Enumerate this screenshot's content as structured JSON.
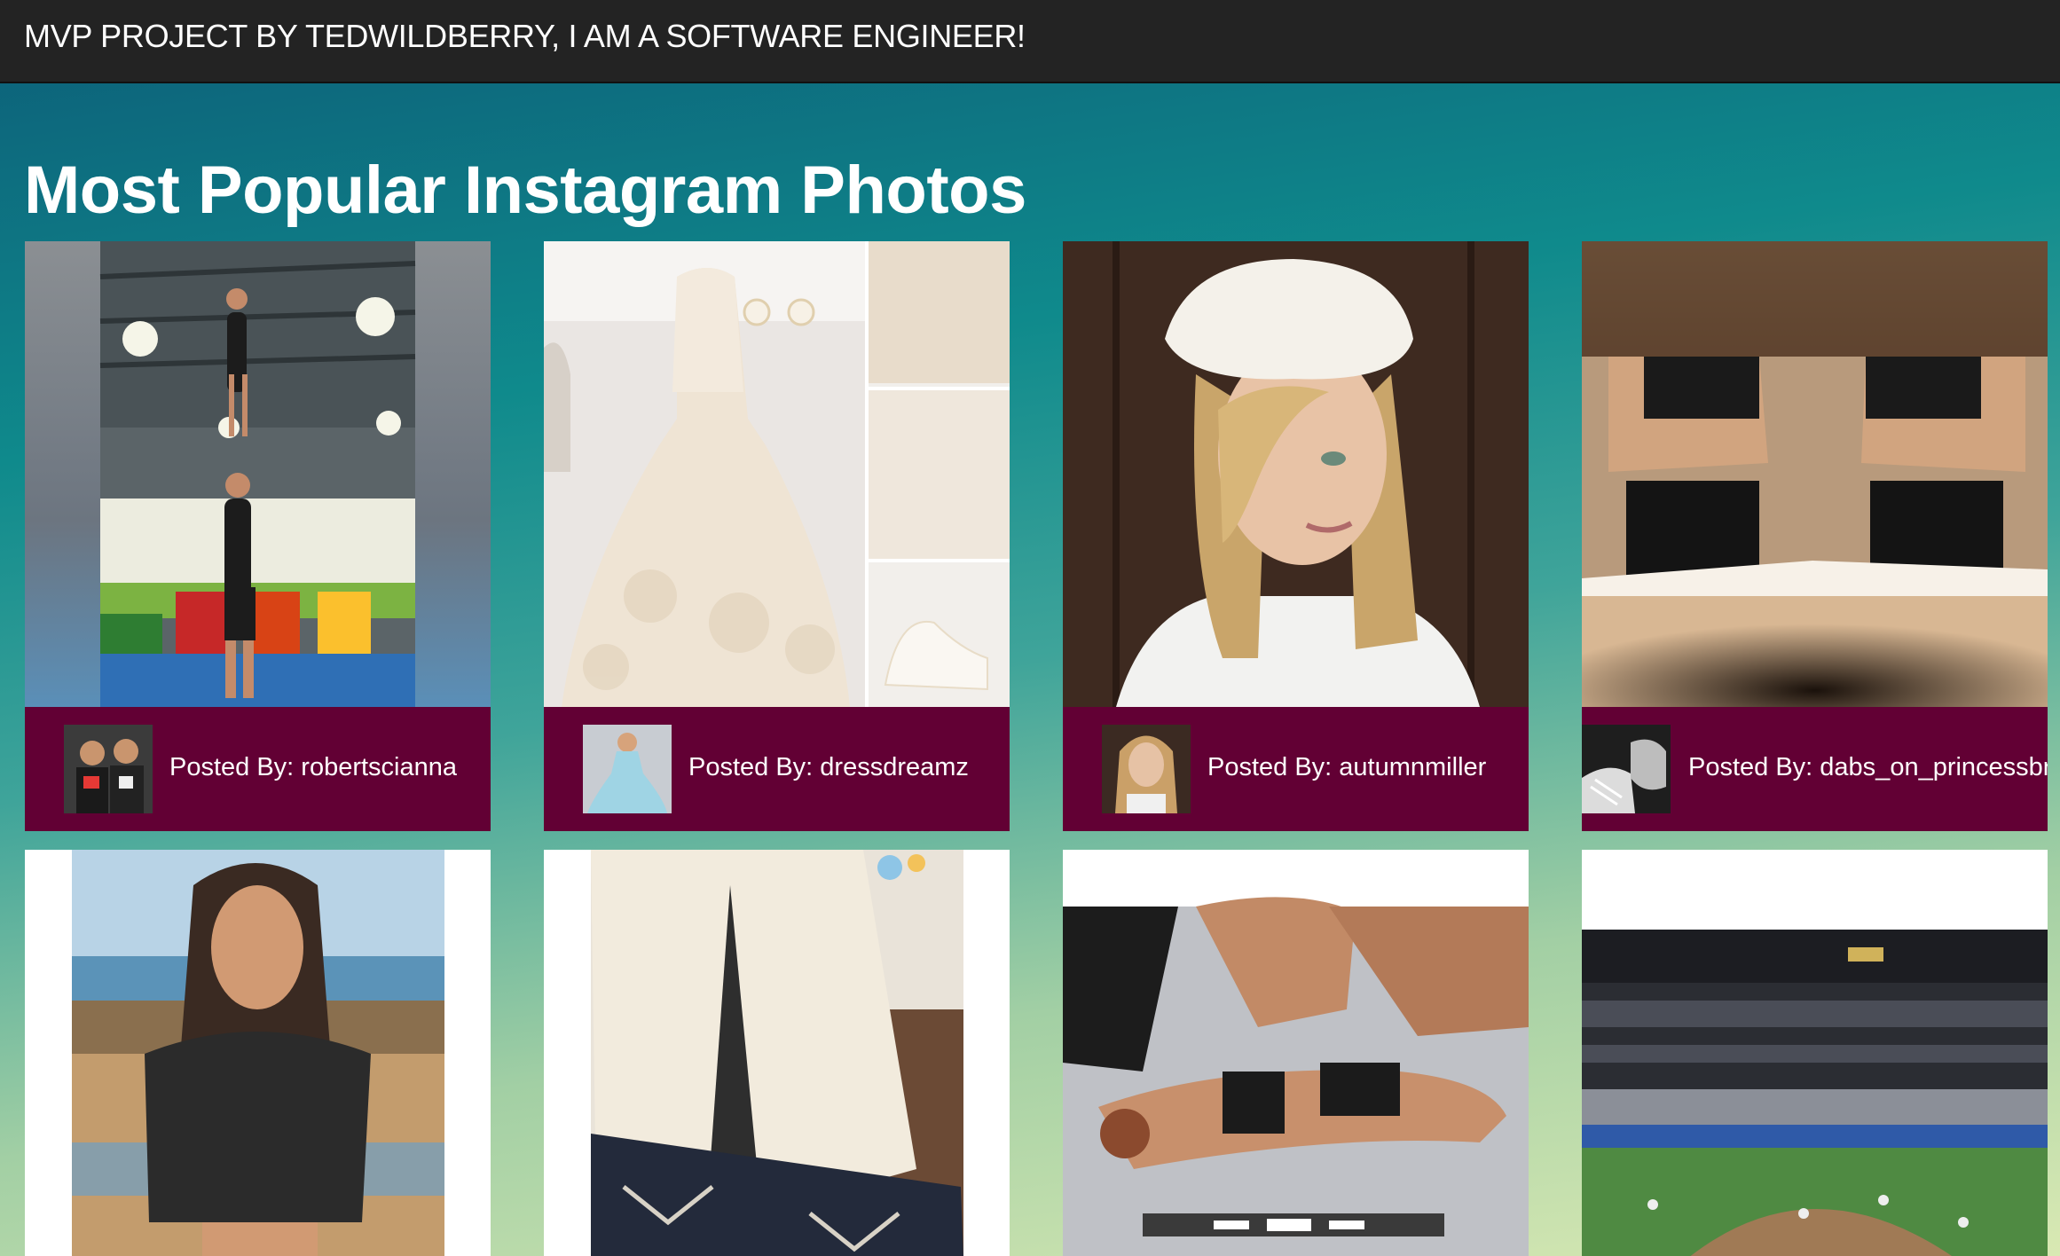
{
  "header": {
    "title": "MVP PROJECT BY TEDWILDBERRY, I AM A SOFTWARE ENGINEER!"
  },
  "main": {
    "heading": "Most Popular Instagram Photos"
  },
  "posts": [
    {
      "caption": "Posted By: robertscianna",
      "photo_icon": "acrobat-photo",
      "avatar_icon": "avatar-two-men"
    },
    {
      "caption": "Posted By: dressdreamz",
      "photo_icon": "wedding-dress-collage",
      "avatar_icon": "avatar-blue-dress"
    },
    {
      "caption": "Posted By: autumnmiller",
      "photo_icon": "blonde-girl-portrait",
      "avatar_icon": "avatar-blonde-girl"
    },
    {
      "caption": "Posted By: dabs_on_princessbri",
      "photo_icon": "mirrored-torso-photo",
      "avatar_icon": "avatar-black-white"
    },
    {
      "photo_icon": "beach-woman-photo"
    },
    {
      "photo_icon": "teepee-tent-photo"
    },
    {
      "photo_icon": "ufc-fight-photo"
    },
    {
      "photo_icon": "baseball-stadium-photo"
    }
  ],
  "colors": {
    "footer": "#620034",
    "topbar": "#232323",
    "text": "#ffffff"
  }
}
